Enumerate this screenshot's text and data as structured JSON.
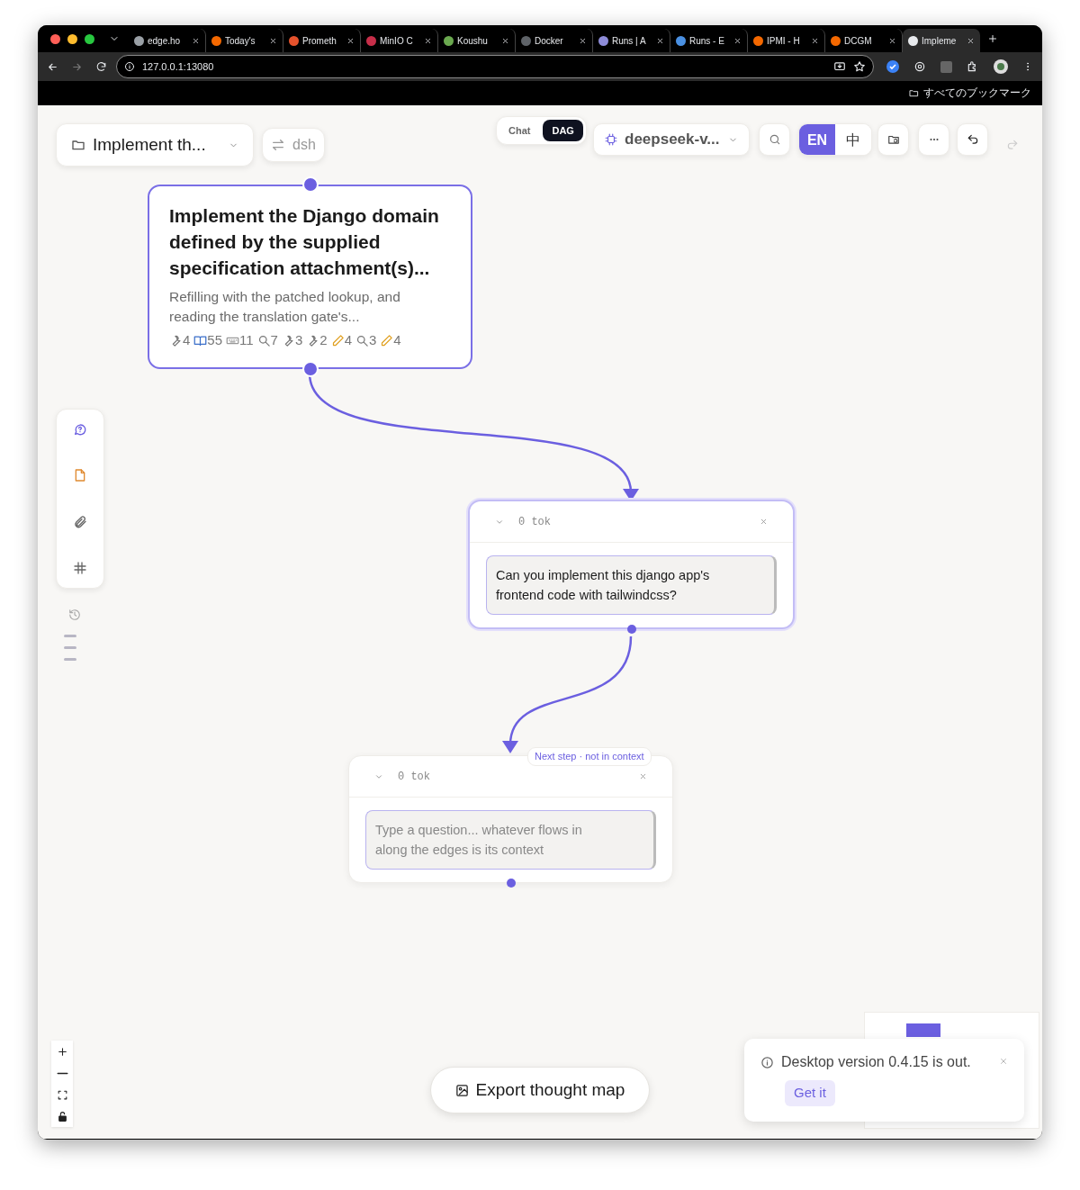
{
  "browser": {
    "tabs": [
      {
        "title": "edge.ho",
        "color": "#9aa0a6",
        "selected": false
      },
      {
        "title": "Today's",
        "color": "#f46800",
        "selected": false
      },
      {
        "title": "Prometh",
        "color": "#e6522c",
        "selected": false
      },
      {
        "title": "MinIO C",
        "color": "#c72e49",
        "selected": false
      },
      {
        "title": "Koushu",
        "color": "#6aa84f",
        "selected": false
      },
      {
        "title": "Docker",
        "color": "#5f6368",
        "selected": false
      },
      {
        "title": "Runs | A",
        "color": "#8e8cd8",
        "selected": false
      },
      {
        "title": "Runs - E",
        "color": "#4a90e2",
        "selected": false
      },
      {
        "title": "IPMI - H",
        "color": "#f46800",
        "selected": false
      },
      {
        "title": "DCGM",
        "color": "#f46800",
        "selected": false
      },
      {
        "title": "Impleme",
        "color": "#e8eaed",
        "selected": true
      }
    ],
    "address": "127.0.0.1:13080",
    "bookmarks": "すべてのブックマーク"
  },
  "toolbar": {
    "project": "Implement th...",
    "branch": "dsh",
    "view_modes": [
      {
        "label": "Chat",
        "selected": false
      },
      {
        "label": "DAG",
        "selected": true
      }
    ],
    "model": "deepseek-v...",
    "languages": [
      {
        "label": "EN",
        "selected": true
      },
      {
        "label": "中",
        "selected": false
      }
    ],
    "redo_disabled": true
  },
  "nodes": [
    {
      "kind": "summary",
      "title": "Implement the Django domain defined by the supplied specification attachment(s)...",
      "description": "Refilling with the patched lookup, and reading the translation gate's...",
      "stats": [
        {
          "kind": "wrench",
          "count": "4"
        },
        {
          "kind": "book",
          "count": "55"
        },
        {
          "kind": "keyboard",
          "count": "11"
        },
        {
          "kind": "search",
          "count": "7"
        },
        {
          "kind": "wrench",
          "count": "3"
        },
        {
          "kind": "wrench",
          "count": "2"
        },
        {
          "kind": "pencil",
          "count": "4"
        },
        {
          "kind": "search",
          "count": "3"
        },
        {
          "kind": "pencil",
          "count": "4"
        }
      ]
    },
    {
      "kind": "question",
      "selected": true,
      "tokens": "0 tok",
      "text": "Can you implement this django app's frontend code with tailwindcss?"
    },
    {
      "kind": "question",
      "selected": false,
      "tokens": "0 tok",
      "placeholder": "Type a question... whatever flows in along the edges is its context",
      "edge_label": "Next step · not in context"
    }
  ],
  "export_button": "Export thought map",
  "toast": {
    "message": "Desktop version 0.4.15 is out.",
    "action": "Get it"
  }
}
